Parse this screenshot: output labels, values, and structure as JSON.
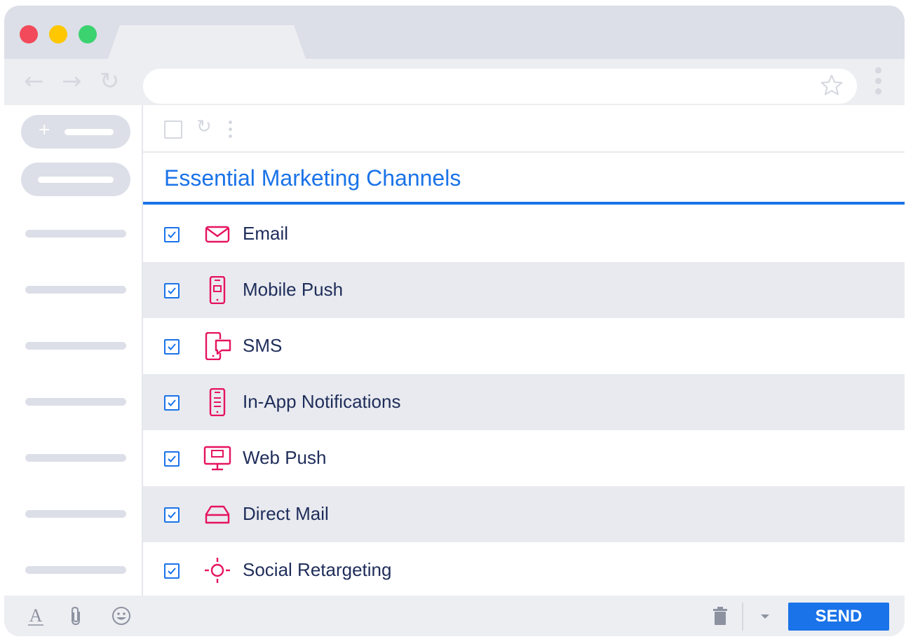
{
  "email": {
    "subject": "Essential Marketing Channels",
    "channels": [
      {
        "label": "Email",
        "icon": "envelope-icon",
        "checked": true
      },
      {
        "label": "Mobile Push",
        "icon": "mobile-phone-icon",
        "checked": true
      },
      {
        "label": "SMS",
        "icon": "sms-chat-icon",
        "checked": true
      },
      {
        "label": "In-App Notifications",
        "icon": "in-app-phone-icon",
        "checked": true
      },
      {
        "label": "Web Push",
        "icon": "desktop-monitor-icon",
        "checked": true
      },
      {
        "label": "Direct Mail",
        "icon": "mailbox-tray-icon",
        "checked": true
      },
      {
        "label": "Social Retargeting",
        "icon": "crosshair-target-icon",
        "checked": true
      }
    ]
  },
  "footer": {
    "send_label": "SEND"
  },
  "colors": {
    "accent": "#1a73e8",
    "icon_pink": "#e6135f",
    "text_dark": "#1f2d5a",
    "chrome_gray": "#dcdfe7"
  }
}
